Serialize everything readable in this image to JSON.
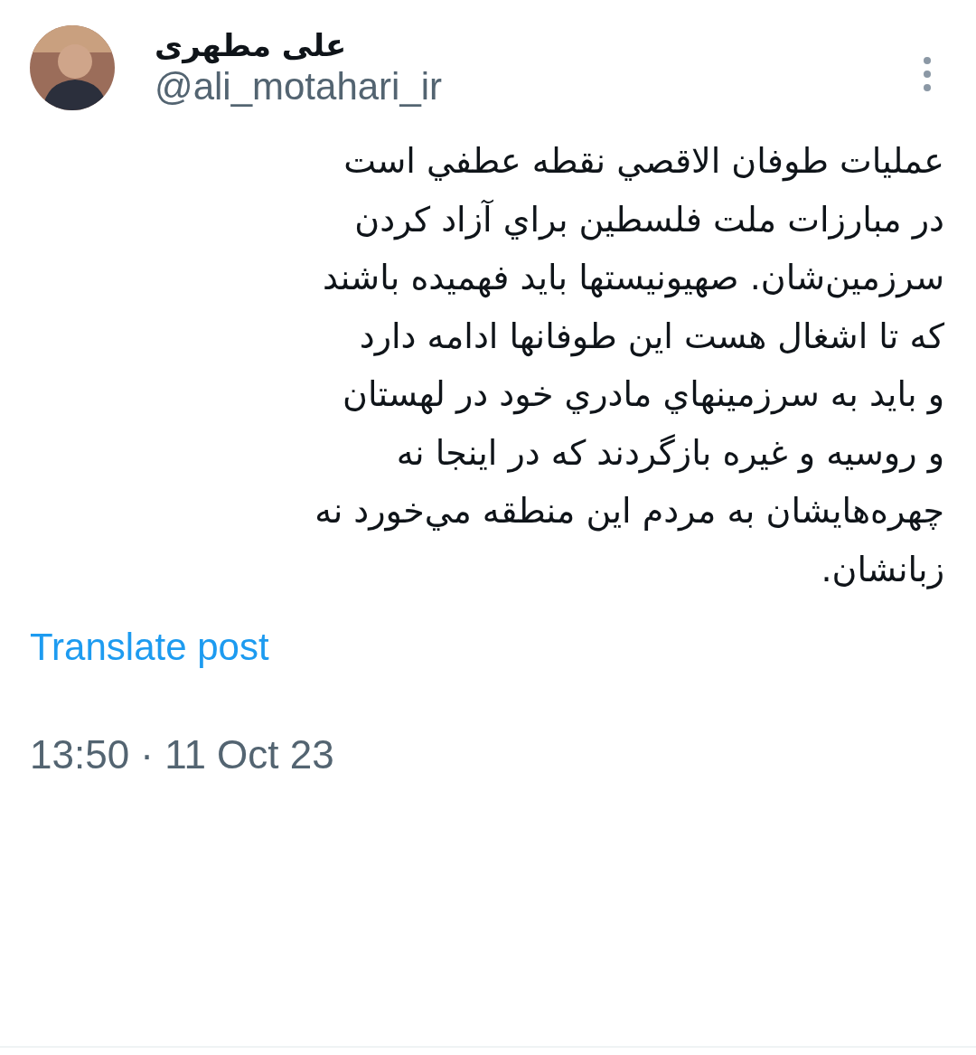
{
  "author": {
    "name": "علی مطهری",
    "handle": "@ali_motahari_ir"
  },
  "post": {
    "text": "عمليات طوفان الاقصي نقطه عطفي است\nدر مبارزات ملت فلسطين براي آزاد کردن\nسرزمين‌شان. صهيونيستها بايد فهميده باشند\nکه تا اشغال هست اين طوفانها ادامه دارد\nو بايد به سرزمينهاي مادري خود در لهستان\nو روسيه و غيره بازگردند که در اينجا نه\nچهره‌هايشان به مردم اين منطقه مي‌خورد نه\nزبانشان."
  },
  "translate_link": "Translate post",
  "timestamp": "13:50 · 11 Oct 23"
}
